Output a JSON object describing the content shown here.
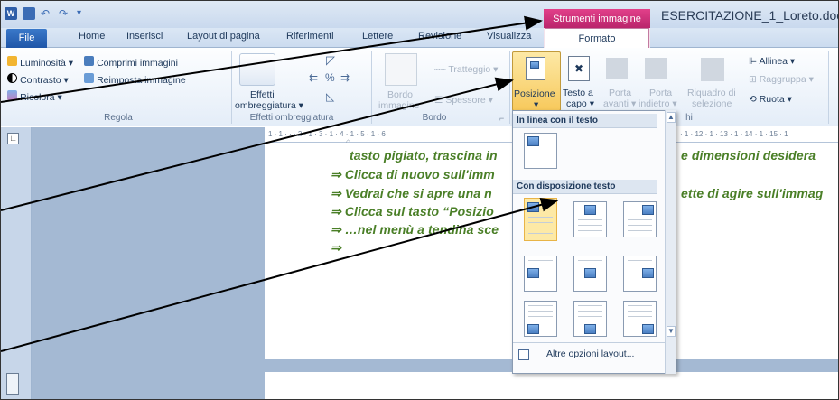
{
  "window": {
    "title": "ESERCITAZIONE_1_Loreto.doc",
    "context_tab_group": "Strumenti immagine"
  },
  "tabs": [
    {
      "label": "File"
    },
    {
      "label": "Home"
    },
    {
      "label": "Inserisci"
    },
    {
      "label": "Layout di pagina"
    },
    {
      "label": "Riferimenti"
    },
    {
      "label": "Lettere"
    },
    {
      "label": "Revisione"
    },
    {
      "label": "Visualizza"
    },
    {
      "label": "Formato"
    }
  ],
  "ribbon": {
    "regola": {
      "group_label": "Regola",
      "luminosita": "Luminosità",
      "comprimi": "Comprimi immagini",
      "contrasto": "Contrasto",
      "reimposta": "Reimposta immagine",
      "ricolora": "Ricolora"
    },
    "effetti_ombreggiatura": {
      "group_label": "Effetti ombreggiatura",
      "button_line1": "Effetti",
      "button_line2": "ombreggiatura"
    },
    "bordo": {
      "group_label": "Bordo",
      "tratteggio": "Tratteggio",
      "spessore": "Spessore",
      "bordo_line1": "Bordo",
      "bordo_line2": "immagine"
    },
    "disponi": {
      "posizione": "Posizione",
      "testo_line1": "Testo a",
      "testo_line2": "capo",
      "porta_avanti_line1": "Porta",
      "porta_avanti_line2": "avanti",
      "porta_indietro_line1": "Porta",
      "porta_indietro_line2": "indietro",
      "riquadro_line1": "Riquadro di",
      "riquadro_line2": "selezione",
      "allinea": "Allinea",
      "raggruppa": "Raggruppa",
      "ruota": "Ruota",
      "group_fragment": "hi"
    }
  },
  "ruler": {
    "text": "1 · 1 · · · 2 · 1 · 3 · 1 · 4 · 1 · 5 · 1 · 6",
    "text_right": "· 1 · 12 · 1 · 13 · 1 · 14 · 1 · 15 · 1"
  },
  "document": {
    "lines": [
      "tasto pigiato, trascina in",
      "⇒ Clicca di nuovo sull'imm",
      "⇒ Vedrai che si apre una n",
      "⇒ Clicca sul tasto “Posizio",
      "⇒ …nel menù a tendina sce",
      "⇒"
    ],
    "right_fragments": [
      "e dimensioni desidera",
      "ette di agire sull'immag"
    ]
  },
  "position_menu": {
    "section_inline": "In linea con il testo",
    "section_wrap": "Con disposizione testo",
    "footer": "Altre opzioni layout..."
  },
  "colors": {
    "accent_context": "#c5236e",
    "doc_text": "#4a7f27",
    "ribbon_text": "#1e395b",
    "selected": "#f7c95c"
  }
}
